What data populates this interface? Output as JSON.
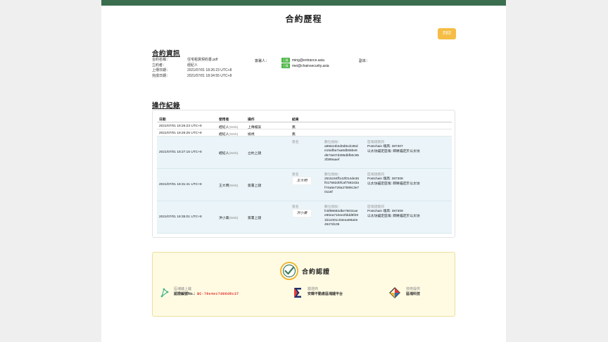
{
  "page": {
    "title": "合約歷程",
    "print_label": "列印"
  },
  "contract_info": {
    "section_title": "合約資訊",
    "fields": [
      {
        "key": "合約名稱：",
        "value": "住宅租賃契約書.pdf"
      },
      {
        "key": "立約者：",
        "value": "經紀人"
      },
      {
        "key": "上傳日期：",
        "value": "2021/07/01 18:26:23 UTC+8"
      },
      {
        "key": "完成日期：",
        "value": "2021/07/01 18:34:55 UTC+8"
      }
    ],
    "signers_label": "簽署人：",
    "signers": [
      {
        "badge": "已簽",
        "email": "ming@entrance.asia"
      },
      {
        "badge": "已簽",
        "email": "mei@chainsecurity.asia"
      }
    ],
    "copies_label": "副本："
  },
  "operation_log": {
    "section_title": "操作紀錄",
    "headers": {
      "date": "日期",
      "user": "使用者",
      "op": "操作",
      "result": "結果"
    },
    "simple_rows": [
      {
        "date": "2021/07/01 18:26:23 UTC+8",
        "user": "經紀人",
        "via": "(Web)",
        "op": "上傳檔案",
        "result": "無"
      },
      {
        "date": "2021/07/01 18:26:26 UTC+8",
        "user": "經紀人",
        "via": "(Web)",
        "op": "檢視",
        "result": "無"
      }
    ],
    "labels": {
      "signature": "簽名",
      "digest": "數位指紋：",
      "chain": "區塊鏈資訊"
    },
    "detail_rows": [
      {
        "date": "2021/07/01 18:27:15 UTC+8",
        "user": "經紀人",
        "via": "(Web)",
        "op": "立約上鏈",
        "signature_image": "",
        "hash_lines": [
          "a95544b2d0d8cdc65d",
          "e16afba7aa6db55be8",
          "d573e07d395dbfb0c95",
          "3f389aaef"
        ],
        "chain_block": "Postchain 塊高: 387307",
        "chain_note": "以太坊錨定區塊: 即將錨定於以太坊"
      },
      {
        "date": "2021/07/01 18:31:41 UTC+8",
        "user": "王大明",
        "via": "(Web)",
        "op": "簽署上鏈",
        "signature_image": "王大明",
        "hash_lines": [
          "2515c84ff142f014de36",
          "f017582d0fcaf756163a",
          "f74a6e729a27889c3e7",
          "0116f"
        ],
        "chain_block": "Postchain 塊高: 387308",
        "chain_note": "以太坊錨定區塊: 即將錨定於以太坊"
      },
      {
        "date": "2021/07/01 18:35:01 UTC+8",
        "user": "洪小美",
        "via": "(Web)",
        "op": "簽署上鏈",
        "signature_image": "洪小美",
        "hash_lines": [
          "fc5f98692dbe7603cae",
          "e90ea710ee2fddd9f29",
          "1b11001c03eea99a0e",
          "4527d105"
        ],
        "chain_block": "Postchain 塊高: 387309",
        "chain_note": "以太坊錨定區塊: 即將錨定於以太坊"
      }
    ]
  },
  "certification": {
    "title": "合約認證",
    "items": [
      {
        "icon": "chain-upload-icon",
        "label": "區塊鏈上鏈",
        "value_prefix": "認證編號No.：",
        "value_id": "BC-78e4ec7d06d8c37"
      },
      {
        "icon": "sigma-icon",
        "label": "驗證商",
        "value": "安韓不動產區塊鏈平台"
      },
      {
        "icon": "diamond-icon",
        "label": "技術提供",
        "value": "區塊科技"
      }
    ]
  },
  "colors": {
    "topbar": "#3b6e4f",
    "print": "#f5bd45",
    "badge": "#4bb543",
    "cert_id": "#e53935",
    "accent_gold": "#f2b534",
    "accent_green": "#3e7d5b"
  }
}
